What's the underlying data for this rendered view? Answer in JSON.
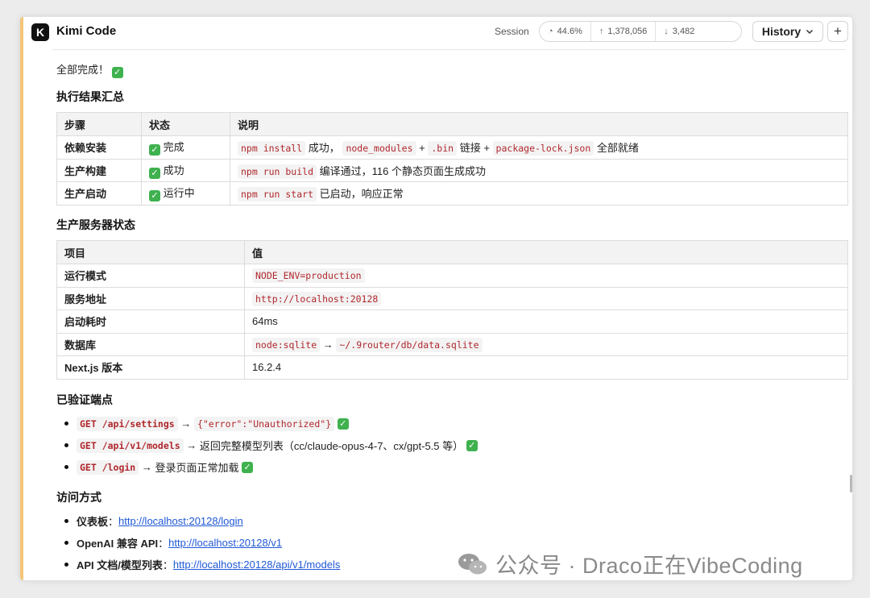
{
  "header": {
    "app_title": "Kimi Code",
    "logo_letter": "K",
    "session_label": "Session",
    "stats": {
      "usage": "44.6%",
      "tokens_up": "1,378,056",
      "tokens_down": "3,482"
    },
    "history_label": "History",
    "new_label": "+"
  },
  "content": {
    "done_text": "全部完成！",
    "section1_title": "执行结果汇总",
    "table1": {
      "headers": [
        "步骤",
        "状态",
        "说明"
      ],
      "rows": [
        {
          "step": "依赖安装",
          "status": "完成",
          "desc_parts": [
            "npm install",
            "成功，",
            "node_modules",
            "+",
            ".bin",
            "链接 +",
            "package-lock.json",
            "全部就绪"
          ]
        },
        {
          "step": "生产构建",
          "status": "成功",
          "desc_parts": [
            "npm run build",
            "编译通过，116 个静态页面生成成功"
          ]
        },
        {
          "step": "生产启动",
          "status": "运行中",
          "desc_parts": [
            "npm run start",
            "已启动，响应正常"
          ]
        }
      ]
    },
    "section2_title": "生产服务器状态",
    "table2": {
      "headers": [
        "项目",
        "值"
      ],
      "rows": [
        {
          "key": "运行模式",
          "code": "NODE_ENV=production"
        },
        {
          "key": "服务地址",
          "code": "http://localhost:20128"
        },
        {
          "key": "启动耗时",
          "text": "64ms"
        },
        {
          "key": "数据库",
          "code": "node:sqlite",
          "arrow": "→",
          "code2": "~/.9router/db/data.sqlite"
        },
        {
          "key": "Next.js 版本",
          "text": "16.2.4"
        }
      ]
    },
    "section3_title": "已验证端点",
    "endpoints": [
      {
        "code": "GET /api/settings",
        "arrow": "→",
        "code2": "{\"error\":\"Unauthorized\"}"
      },
      {
        "code": "GET /api/v1/models",
        "arrow": "→",
        "text": "返回完整模型列表（cc/claude-opus-4-7、cx/gpt-5.5 等）"
      },
      {
        "code": "GET /login",
        "arrow": "→",
        "text": "登录页面正常加载"
      }
    ],
    "section4_title": "访问方式",
    "access": [
      {
        "label": "仪表板",
        "sep": "：",
        "url": "http://localhost:20128/login"
      },
      {
        "label": "OpenAI 兼容 API",
        "sep": "：",
        "url": "http://localhost:20128/v1"
      },
      {
        "label": "API 文档/模型列表",
        "sep": "：",
        "url": "http://localhost:20128/api/v1/models"
      }
    ]
  },
  "watermark": "公众号 · Draco正在VibeCoding",
  "check_glyph": "✓",
  "colors": {
    "accent_bar": "#f3c57a",
    "code_text": "#b0282d",
    "link": "#1f58d6",
    "check": "#3fb14f"
  }
}
